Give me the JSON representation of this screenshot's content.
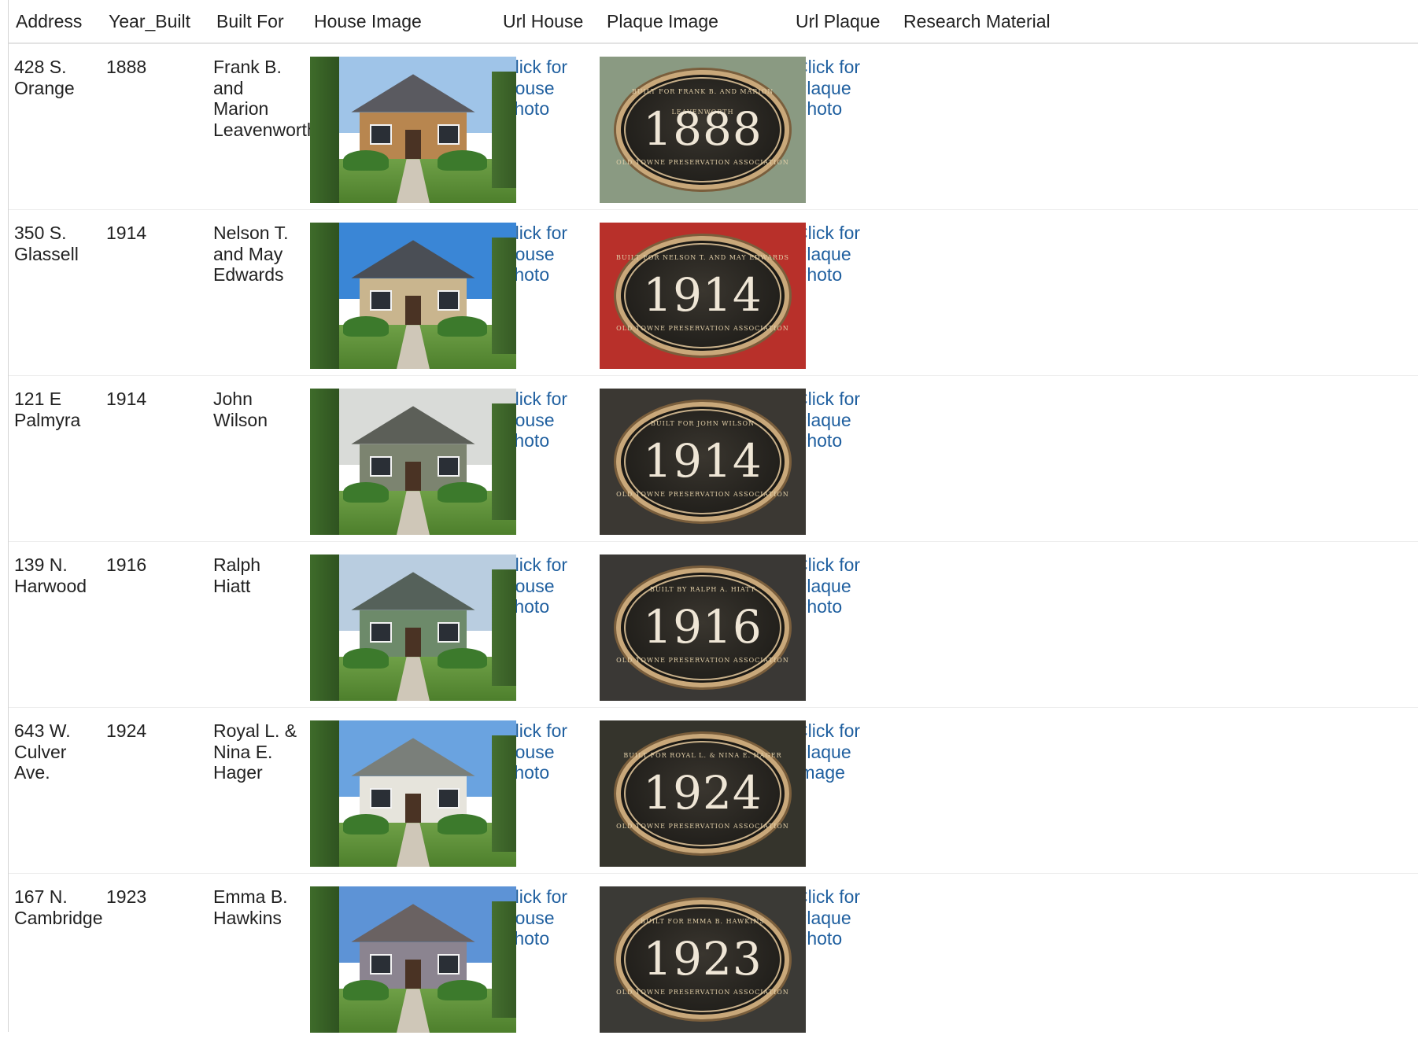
{
  "columns": [
    "Address",
    "Year_Built",
    "Built For",
    "House Image",
    "Url House",
    "Plaque Image",
    "Url Plaque",
    "Research Material"
  ],
  "rows": [
    {
      "address": "428 S. Orange",
      "year": "1888",
      "built_for": "Frank B. and Marion Leavenworth",
      "url_house": "Click for House Photo",
      "url_plaque": "Click for Plaque Photo",
      "plaque_top": "BUILT FOR FRANK B. AND MARION LEAVENWORTH",
      "plaque_bottom": "OLD TOWNE PRESERVATION ASSOCIATION",
      "plaque_bg": "#8a9a82",
      "house_sky": "#9fc4e8",
      "house_roof": "#5a5a60",
      "house_wall": "#b8864f"
    },
    {
      "address": "350 S. Glassell",
      "year": "1914",
      "built_for": "Nelson T. and May Edwards",
      "url_house": "Click for House Photo",
      "url_plaque": "Click for Plaque Photo",
      "plaque_top": "BUILT FOR NELSON T. AND MAY EDWARDS",
      "plaque_bottom": "OLD TOWNE PRESERVATION ASSOCIATION",
      "plaque_bg": "#b8302a",
      "house_sky": "#3a86d6",
      "house_roof": "#4a4e55",
      "house_wall": "#c9b58e"
    },
    {
      "address": "121 E Palmyra",
      "year": "1914",
      "built_for": "John Wilson",
      "url_house": "Click for House Photo",
      "url_plaque": "Click for Plaque Photo",
      "plaque_top": "BUILT FOR JOHN WILSON",
      "plaque_bottom": "OLD TOWNE PRESERVATION ASSOCIATION",
      "plaque_bg": "#3b3833",
      "house_sky": "#d9dbd8",
      "house_roof": "#5c5f58",
      "house_wall": "#7c8470"
    },
    {
      "address": "139 N. Harwood",
      "year": "1916",
      "built_for": "Ralph Hiatt",
      "url_house": "Click for House Photo",
      "url_plaque": "Click for Plaque Photo",
      "plaque_top": "BUILT BY RALPH A. HIATT",
      "plaque_bottom": "OLD TOWNE PRESERVATION ASSOCIATION",
      "plaque_bg": "#3a3835",
      "house_sky": "#b9cde0",
      "house_roof": "#55615a",
      "house_wall": "#6d8a6a"
    },
    {
      "address": "643 W. Culver Ave.",
      "year": "1924",
      "built_for": "Royal L. & Nina E. Hager",
      "url_house": "Click for House Photo",
      "url_plaque": "Click for Plaque Image",
      "plaque_top": "BUILT FOR ROYAL L. & NINA E. HAGER",
      "plaque_bottom": "OLD TOWNE PRESERVATION ASSOCIATION",
      "plaque_bg": "#35342c",
      "house_sky": "#6aa3e0",
      "house_roof": "#7a7f7a",
      "house_wall": "#e6e4dc"
    },
    {
      "address": "167 N. Cambridge",
      "year": "1923",
      "built_for": "Emma B. Hawkins",
      "url_house": "Click for House Photo",
      "url_plaque": "Click for Plaque Photo",
      "plaque_top": "BUILT FOR EMMA B. HAWKINS",
      "plaque_bottom": "OLD TOWNE PRESERVATION ASSOCIATION",
      "plaque_bg": "#3b3a36",
      "house_sky": "#5d93d6",
      "house_roof": "#6a6262",
      "house_wall": "#8b8490"
    }
  ]
}
